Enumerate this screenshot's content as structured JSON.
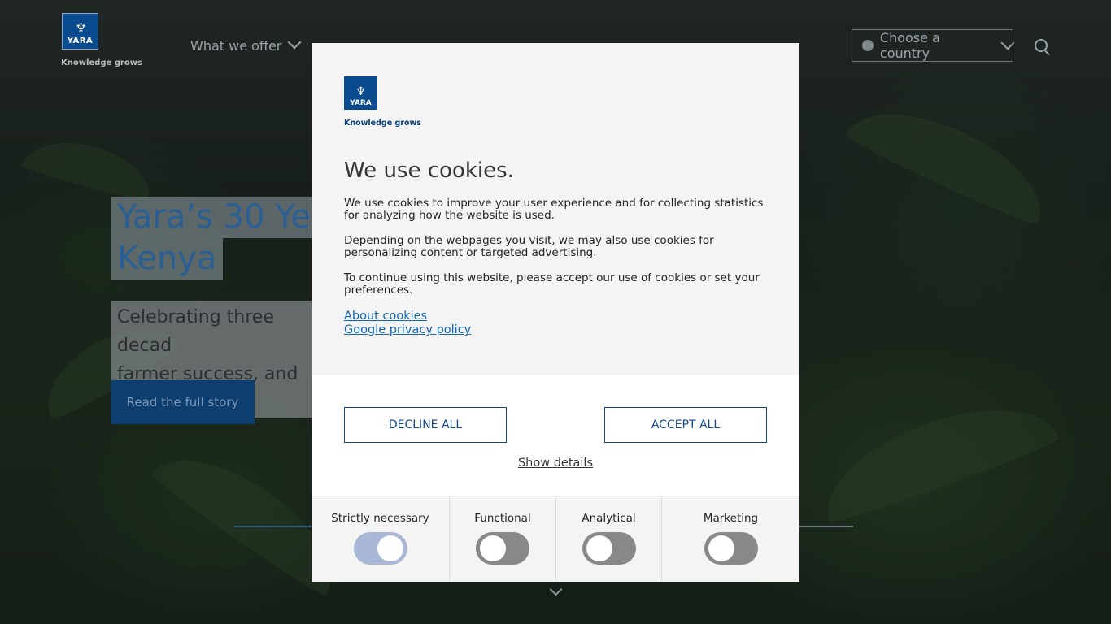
{
  "header": {
    "logo_word": "YARA",
    "logo_tagline": "Knowledge grows",
    "nav": [
      {
        "label": "What we offer"
      }
    ],
    "country_selector": "Choose a country"
  },
  "hero": {
    "title_line1": "Yara’s 30 Ye",
    "title_line2": "Kenya",
    "subtitle_line1": "Celebrating three decad",
    "subtitle_line2": "farmer success, and pro",
    "cta": "Read the full story"
  },
  "cookie_dialog": {
    "logo_word": "YARA",
    "logo_tagline": "Knowledge grows",
    "title": "We use cookies.",
    "paragraphs": [
      "We use cookies to improve your user experience and for collecting statistics for analyzing how the website is used.",
      "Depending on the webpages you visit, we may also use cookies for personalizing content or targeted advertising.",
      "To continue using this website, please accept our use of cookies or set your preferences."
    ],
    "links": [
      "About cookies",
      "Google privacy policy"
    ],
    "decline_label": "DECLINE ALL",
    "accept_label": "ACCEPT ALL",
    "show_details": "Show details",
    "preferences": [
      {
        "label": "Strictly necessary",
        "enabled": true
      },
      {
        "label": "Functional",
        "enabled": false
      },
      {
        "label": "Analytical",
        "enabled": false
      },
      {
        "label": "Marketing",
        "enabled": false
      }
    ]
  },
  "colors": {
    "brand_blue": "#0a4a8f",
    "link_blue": "#1366b3",
    "button_border": "#11488a"
  }
}
